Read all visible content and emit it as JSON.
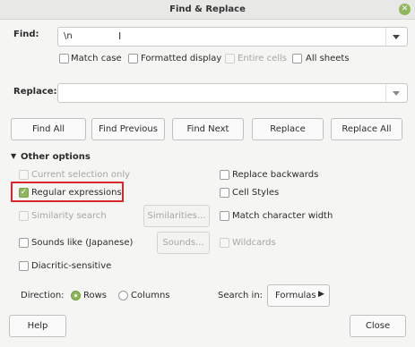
{
  "window": {
    "title": "Find & Replace",
    "close_symbol": "✕"
  },
  "find": {
    "label": "Find:",
    "value": "\\n"
  },
  "find_options": {
    "match_case": "Match case",
    "formatted_display": "Formatted display",
    "entire_cells": "Entire cells",
    "all_sheets": "All sheets"
  },
  "replace": {
    "label": "Replace:",
    "value": ""
  },
  "buttons": {
    "find_all": "Find All",
    "find_previous": "Find Previous",
    "find_next": "Find Next",
    "replace": "Replace",
    "replace_all": "Replace All"
  },
  "other_options": {
    "header": "Other options",
    "current_selection_only": "Current selection only",
    "replace_backwards": "Replace backwards",
    "regular_expressions": "Regular expressions",
    "regular_expressions_checked": true,
    "cell_styles": "Cell Styles",
    "similarity_search": "Similarity search",
    "similarities_button": "Similarities...",
    "match_character_width": "Match character width",
    "sounds_like": "Sounds like (Japanese)",
    "sounds_button": "Sounds...",
    "wildcards": "Wildcards",
    "diacritic_sensitive": "Diacritic-sensitive"
  },
  "direction": {
    "label": "Direction:",
    "rows": "Rows",
    "columns": "Columns",
    "selected": "Rows"
  },
  "search_in": {
    "label": "Search in:",
    "value": "Formulas"
  },
  "footer": {
    "help": "Help",
    "close": "Close"
  },
  "colors": {
    "accent": "#8fb85d",
    "highlight": "#d9262b"
  }
}
